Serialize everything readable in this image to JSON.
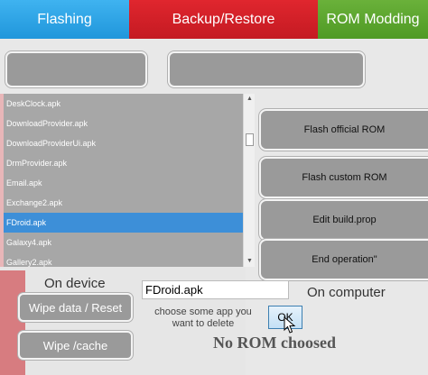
{
  "tabs": [
    {
      "label": "Flashing"
    },
    {
      "label": "Backup/Restore"
    },
    {
      "label": "ROM Modding"
    }
  ],
  "apk_list": {
    "items": [
      "DeskClock.apk",
      "DownloadProvider.apk",
      "DownloadProviderUi.apk",
      "DrmProvider.apk",
      "Email.apk",
      "Exchange2.apk",
      "FDroid.apk",
      "Galaxy4.apk",
      "Gallery2.apk"
    ],
    "selected": "FDroid.apk"
  },
  "actions": {
    "flash_official": "Flash official ROM",
    "flash_custom": "Flash custom ROM",
    "edit_build_prop": "Edit build.prop",
    "end_operation": "End operation\""
  },
  "device": {
    "label": "On device",
    "wipe_data": "Wipe data / Reset",
    "wipe_cache": "Wipe /cache"
  },
  "computer": {
    "label": "On computer"
  },
  "delete": {
    "input_value": "FDroid.apk",
    "hint": "choose some app you want to delete",
    "ok_label": "OK"
  },
  "status": "No ROM choosed",
  "colors": {
    "flash_tab": "#2096db",
    "backup_tab": "#c41a22",
    "rom_tab": "#4f9a24",
    "selection": "#3d8fd8"
  }
}
